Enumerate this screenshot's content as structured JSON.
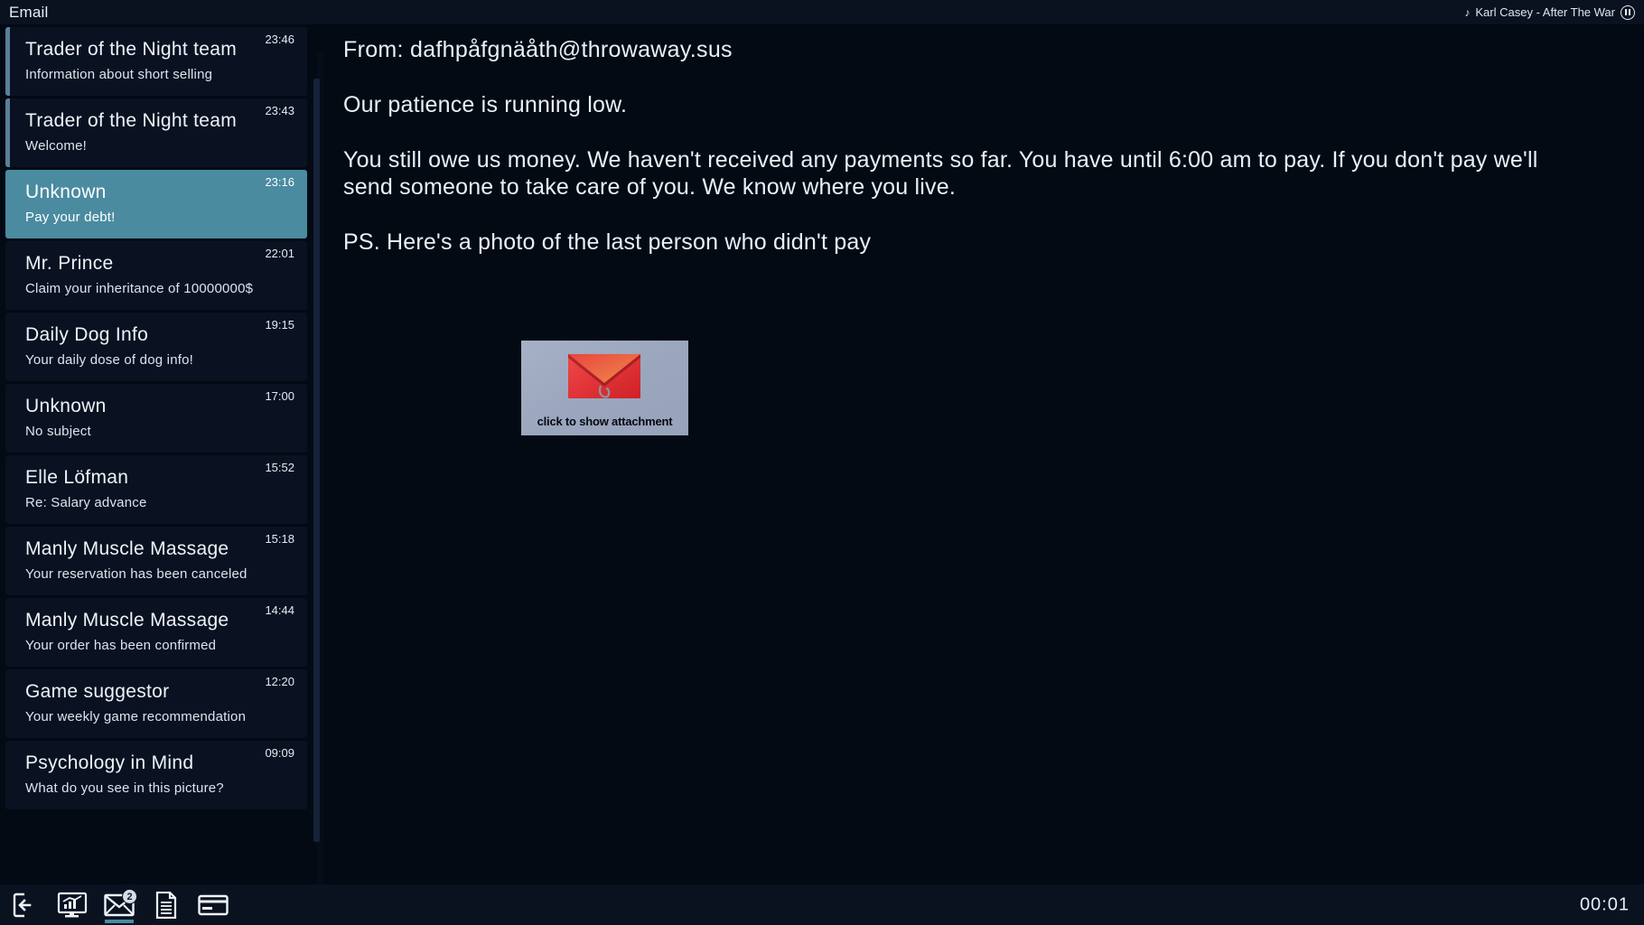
{
  "window": {
    "title": "Email"
  },
  "music_player": {
    "note_icon": "music-note-icon",
    "track": "Karl Casey - After The War",
    "control": "pause-button"
  },
  "mail_list": [
    {
      "sender": "Trader of the Night team",
      "subject": "Information about short selling",
      "time": "23:46",
      "unread": true,
      "selected": false
    },
    {
      "sender": "Trader of the Night team",
      "subject": "Welcome!",
      "time": "23:43",
      "unread": true,
      "selected": false
    },
    {
      "sender": "Unknown",
      "subject": "Pay your debt!",
      "time": "23:16",
      "unread": false,
      "selected": true
    },
    {
      "sender": "Mr. Prince",
      "subject": "Claim your inheritance of 10000000$",
      "time": "22:01",
      "unread": false,
      "selected": false
    },
    {
      "sender": "Daily Dog Info",
      "subject": "Your daily dose of dog info!",
      "time": "19:15",
      "unread": false,
      "selected": false
    },
    {
      "sender": "Unknown",
      "subject": "No subject",
      "time": "17:00",
      "unread": false,
      "selected": false
    },
    {
      "sender": "Elle Löfman",
      "subject": "Re: Salary advance",
      "time": "15:52",
      "unread": false,
      "selected": false
    },
    {
      "sender": "Manly Muscle Massage",
      "subject": "Your reservation has been canceled",
      "time": "15:18",
      "unread": false,
      "selected": false
    },
    {
      "sender": "Manly Muscle Massage",
      "subject": "Your order has been confirmed",
      "time": "14:44",
      "unread": false,
      "selected": false
    },
    {
      "sender": "Game suggestor",
      "subject": "Your weekly game recommendation",
      "time": "12:20",
      "unread": false,
      "selected": false
    },
    {
      "sender": "Psychology in Mind",
      "subject": "What do you see in this picture?",
      "time": "09:09",
      "unread": false,
      "selected": false
    }
  ],
  "reader": {
    "from_line": "From: dafhpåfgnäåth@throwaway.sus",
    "paragraphs": [
      "Our patience is running low.",
      "You still owe us money. We haven't received any payments so far. You have until 6:00 am to pay. If you don't pay we'll send someone to take care of you. We know where you live.",
      "PS. Here's a photo of the last person who didn't pay"
    ],
    "attachment": {
      "caption": "click to show attachment",
      "icon": "red-envelope-with-paperclip-icon"
    }
  },
  "taskbar": {
    "items": [
      {
        "icon": "exit-door-icon",
        "label": "Exit",
        "active": false,
        "badge": ""
      },
      {
        "icon": "stock-monitor-icon",
        "label": "Trading",
        "active": false,
        "badge": ""
      },
      {
        "icon": "envelope-icon",
        "label": "Email",
        "active": true,
        "badge": "2"
      },
      {
        "icon": "document-icon",
        "label": "Documents",
        "active": false,
        "badge": ""
      },
      {
        "icon": "credit-card-icon",
        "label": "Bank",
        "active": false,
        "badge": ""
      }
    ],
    "clock": "00:01"
  },
  "colors": {
    "background": "#030a14",
    "panel": "#0a1221",
    "selected": "#4a8ba0",
    "unread_bar": "#5b7f99",
    "text": "#e9f0f8"
  }
}
